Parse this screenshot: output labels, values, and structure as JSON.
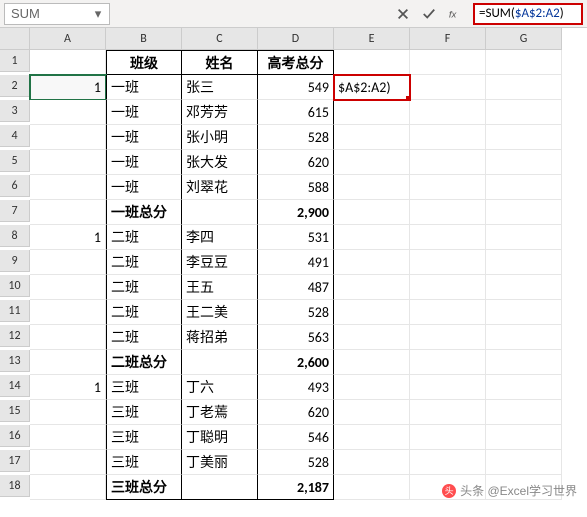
{
  "formula_bar": {
    "name_box": "SUM",
    "formula_prefix": "=SUM(",
    "formula_ref": "$A$2:A2",
    "formula_suffix": ")"
  },
  "columns": [
    "A",
    "B",
    "C",
    "D",
    "E",
    "F",
    "G"
  ],
  "row_numbers": [
    1,
    2,
    3,
    4,
    5,
    6,
    7,
    8,
    9,
    10,
    11,
    12,
    13,
    14,
    15,
    16,
    17,
    18
  ],
  "header": {
    "B": "班级",
    "C": "姓名",
    "D": "高考总分"
  },
  "rows": [
    {
      "A": "1",
      "B": "一班",
      "C": "张三",
      "D": "549"
    },
    {
      "A": "",
      "B": "一班",
      "C": "邓芳芳",
      "D": "615"
    },
    {
      "A": "",
      "B": "一班",
      "C": "张小明",
      "D": "528"
    },
    {
      "A": "",
      "B": "一班",
      "C": "张大发",
      "D": "620"
    },
    {
      "A": "",
      "B": "一班",
      "C": "刘翠花",
      "D": "588"
    },
    {
      "A": "",
      "B": "一班总分",
      "C": "",
      "D": "2,900",
      "bold": true
    },
    {
      "A": "1",
      "B": "二班",
      "C": "李四",
      "D": "531"
    },
    {
      "A": "",
      "B": "二班",
      "C": "李豆豆",
      "D": "491"
    },
    {
      "A": "",
      "B": "二班",
      "C": "王五",
      "D": "487"
    },
    {
      "A": "",
      "B": "二班",
      "C": "王二美",
      "D": "528"
    },
    {
      "A": "",
      "B": "二班",
      "C": "蒋招弟",
      "D": "563"
    },
    {
      "A": "",
      "B": "二班总分",
      "C": "",
      "D": "2,600",
      "bold": true
    },
    {
      "A": "1",
      "B": "三班",
      "C": "丁六",
      "D": "493"
    },
    {
      "A": "",
      "B": "三班",
      "C": "丁老蔫",
      "D": "620"
    },
    {
      "A": "",
      "B": "三班",
      "C": "丁聪明",
      "D": "546"
    },
    {
      "A": "",
      "B": "三班",
      "C": "丁美丽",
      "D": "528"
    },
    {
      "A": "",
      "B": "三班总分",
      "C": "",
      "D": "2,187",
      "bold": true
    }
  ],
  "e2_display": "$A$2:A2)",
  "watermark": "头条 @Excel学习世界"
}
